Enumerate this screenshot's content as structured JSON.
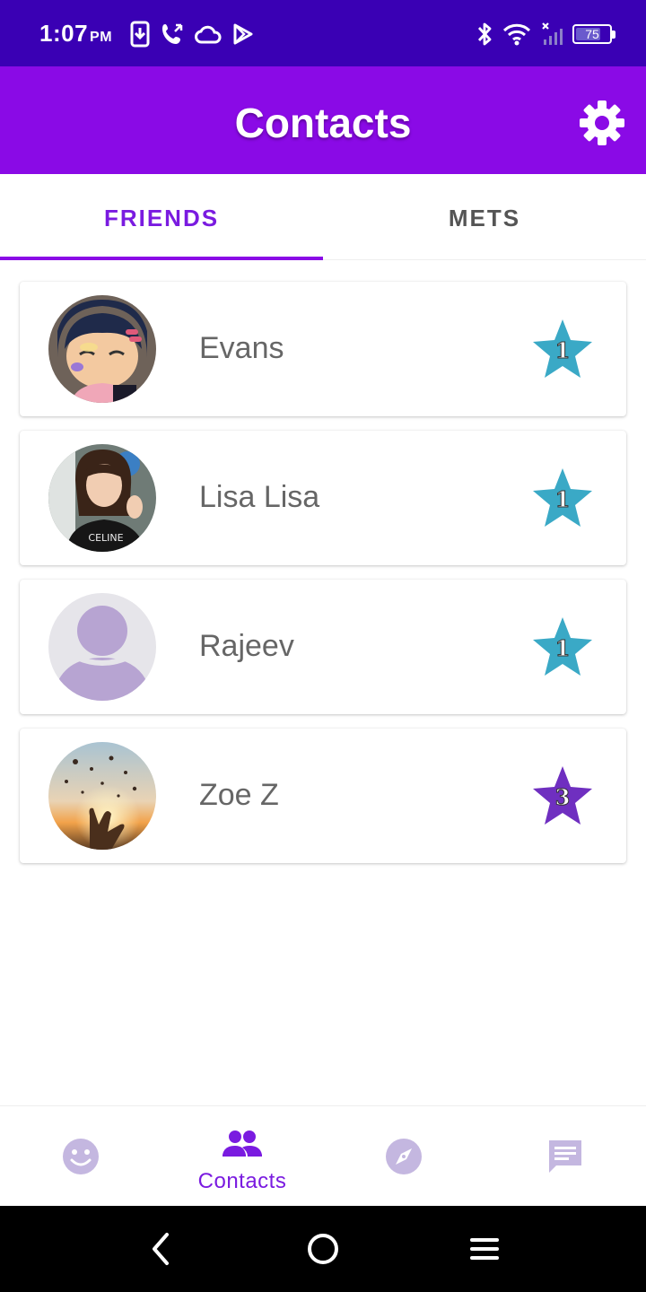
{
  "status_bar": {
    "time": "1:07",
    "ampm": "PM",
    "battery": "75",
    "battery_level": 0.75
  },
  "app_bar": {
    "title": "Contacts",
    "settings_icon": "gear-icon"
  },
  "tabs": [
    {
      "label": "FRIENDS",
      "active": true
    },
    {
      "label": "METS",
      "active": false
    }
  ],
  "contacts": [
    {
      "name": "Evans",
      "level": "1",
      "star_color": "#3aa9c6"
    },
    {
      "name": "Lisa Lisa",
      "level": "1",
      "star_color": "#3aa9c6"
    },
    {
      "name": "Rajeev",
      "level": "1",
      "star_color": "#3aa9c6"
    },
    {
      "name": "Zoe Z",
      "level": "3",
      "star_color": "#6f2fc0"
    }
  ],
  "bottom_nav": {
    "items": [
      {
        "icon": "smiley-icon",
        "label": ""
      },
      {
        "icon": "people-icon",
        "label": "Contacts",
        "active": true
      },
      {
        "icon": "compass-icon",
        "label": ""
      },
      {
        "icon": "chat-icon",
        "label": ""
      }
    ]
  },
  "colors": {
    "status_bar": "#3a00b4",
    "app_bar": "#8a0ae6",
    "accent": "#7a1be0",
    "inactive_icon": "#c4b7e0"
  }
}
